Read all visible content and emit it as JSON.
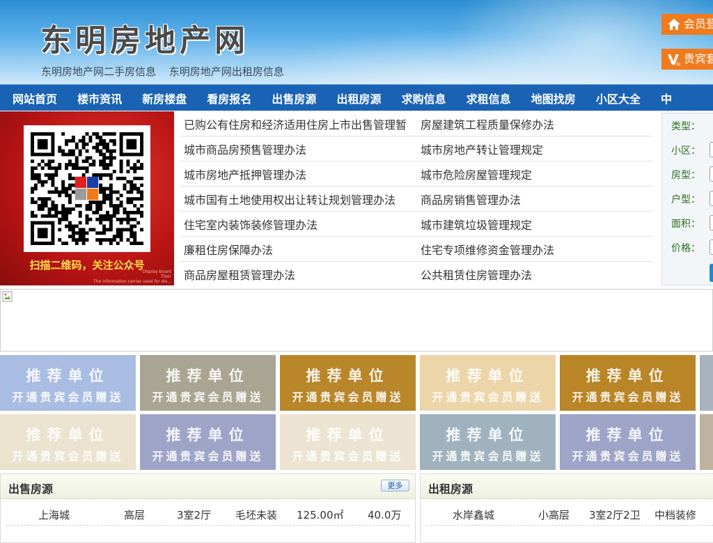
{
  "header": {
    "site_title": "东明房地产网",
    "sub_links": [
      "东明房地产网二手房信息",
      "东明房地产网出租房信息"
    ],
    "login_label": "会员登",
    "vip_label": "贵宾套"
  },
  "nav": {
    "items": [
      "网站首页",
      "楼市资讯",
      "新房楼盘",
      "看房报名",
      "出售房源",
      "出租房源",
      "求购信息",
      "求租信息",
      "地图找房",
      "小区大全",
      "中"
    ]
  },
  "qr_banner": {
    "caption": "扫描二维码，关注公众号",
    "small_text": [
      "Display board",
      "Their",
      "The information carrier used for dis..."
    ]
  },
  "policy": {
    "rows": [
      [
        "已购公有住房和经济适用住房上市出售管理暂",
        "房屋建筑工程质量保修办法"
      ],
      [
        "城市商品房预售管理办法",
        "城市房地产转让管理规定"
      ],
      [
        "城市房地产抵押管理办法",
        "城市危险房屋管理规定"
      ],
      [
        "城市国有土地使用权出让转让规划管理办法",
        "商品房销售管理办法"
      ],
      [
        "住宅室内装饰装修管理办法",
        "城市建筑垃圾管理规定"
      ],
      [
        "廉租住房保障办法",
        "住宅专项维修资金管理办法"
      ],
      [
        "商品房屋租赁管理办法",
        "公共租赁住房管理办法"
      ]
    ]
  },
  "search": {
    "labels": [
      "类型：",
      "小区：",
      "房型：",
      "户型：",
      "面积：",
      "价格："
    ]
  },
  "tiles": {
    "line1": "推荐单位",
    "line2": "开通贵宾会员赠送",
    "colors_row1": [
      "#a9bde2",
      "#aaa592",
      "#b9862a",
      "#ecd6a9",
      "#b98526",
      "#a9b3bd"
    ],
    "colors_row2": [
      "#ebe2cf",
      "#9da4c8",
      "#ece3d2",
      "#9fb2bd",
      "#9da4c8",
      "#bdb3a0"
    ]
  },
  "sale_panel": {
    "title": "出售房源",
    "more_label": "更多",
    "rows": [
      [
        "上海城",
        "高层",
        "3室2厅",
        "毛坯未装",
        "125.00㎡",
        "40.0万"
      ]
    ]
  },
  "rent_panel": {
    "title": "出租房源",
    "rows": [
      [
        "水岸鑫城",
        "小高层",
        "3室2厅2卫",
        "中档装修"
      ]
    ]
  }
}
